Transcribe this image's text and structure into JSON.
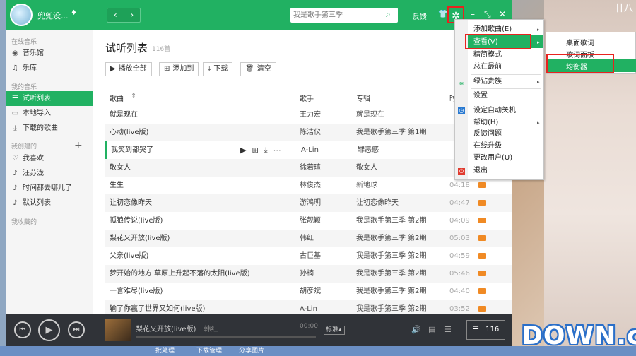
{
  "desktop": {
    "clock_char": "廿八"
  },
  "titlebar": {
    "username": "兜兜没...",
    "search_placeholder": "我是歌手第三季",
    "feedback": "反馈"
  },
  "sidebar": {
    "section_online": "在线音乐",
    "music_hall": "音乐馆",
    "library": "乐库",
    "section_my": "我的音乐",
    "trial_list": "试听列表",
    "local_import": "本地导入",
    "downloaded": "下载的歌曲",
    "section_created": "我创建的",
    "playlists": [
      "我喜欢",
      "汪苏泷",
      "时间都去哪儿了",
      "默认列表"
    ],
    "section_collected": "我收藏的"
  },
  "main": {
    "title": "试听列表",
    "count": "116首",
    "actions": {
      "play_all": "播放全部",
      "add_to": "添加到",
      "download": "下载",
      "clear": "清空"
    },
    "columns": {
      "song": "歌曲",
      "singer": "歌手",
      "album": "专辑",
      "duration": "时"
    },
    "rows": [
      {
        "song": "就是现在",
        "singer": "王力宏",
        "album": "就是现在",
        "duration": ""
      },
      {
        "song": "心动(live版)",
        "singer": "陈洁仪",
        "album": "我是歌手第三季 第1期",
        "duration": ""
      },
      {
        "song": "我笑到都哭了",
        "singer": "A-Lin",
        "album": "罪恶感",
        "duration": ""
      },
      {
        "song": "敬女人",
        "singer": "徐若瑄",
        "album": "敬女人",
        "duration": ""
      },
      {
        "song": "生生",
        "singer": "林俊杰",
        "album": "新地球",
        "duration": "04:18"
      },
      {
        "song": "让初恋像昨天",
        "singer": "游鸿明",
        "album": "让初恋像昨天",
        "duration": "04:47"
      },
      {
        "song": "孤狼传说(live版)",
        "singer": "张靓颖",
        "album": "我是歌手第三季 第2期",
        "duration": "04:09"
      },
      {
        "song": "梨花又开放(live版)",
        "singer": "韩红",
        "album": "我是歌手第三季 第2期",
        "duration": "05:03"
      },
      {
        "song": "父亲(live版)",
        "singer": "古巨基",
        "album": "我是歌手第三季 第2期",
        "duration": "04:59"
      },
      {
        "song": "梦开始的地方  草原上升起不落的太阳(live版)",
        "singer": "孙楠",
        "album": "我是歌手第三季 第2期",
        "duration": "05:46"
      },
      {
        "song": "一言难尽(live版)",
        "singer": "胡彦斌",
        "album": "我是歌手第三季 第2期",
        "duration": "04:40"
      },
      {
        "song": "输了你赢了世界又如何(live版)",
        "singer": "A-Lin",
        "album": "我是歌手第三季 第2期",
        "duration": "03:52"
      }
    ]
  },
  "menu": {
    "items": [
      {
        "label": "添加歌曲(E)",
        "arrow": true
      },
      {
        "label": "查看(V)",
        "arrow": true
      },
      {
        "label": "精简模式",
        "arrow": false
      },
      {
        "label": "总在最前",
        "arrow": false
      },
      {
        "label": "绿钻贵族",
        "arrow": true
      },
      {
        "label": "设置",
        "arrow": false
      },
      {
        "label": "设定自动关机",
        "arrow": false
      },
      {
        "label": "帮助(H)",
        "arrow": true
      },
      {
        "label": "反馈问题",
        "arrow": false
      },
      {
        "label": "在线升级",
        "arrow": false
      },
      {
        "label": "更改用户(U)",
        "arrow": false
      },
      {
        "label": "退出",
        "arrow": false
      }
    ],
    "sub_items": [
      "桌面歌词",
      "歌词面板",
      "均衡器"
    ]
  },
  "player": {
    "now_playing": "梨花又开放(live版)",
    "artist": "韩红",
    "time": "00:00",
    "quality": "标准",
    "list_count": "116"
  },
  "taskbar": {
    "items": [
      "批处理",
      "下载管理",
      "分享图片"
    ]
  },
  "watermark": "DOWN.cc",
  "colors": {
    "accent": "#21b162",
    "highlight_box": "#e8231f",
    "player_bg": "#303338"
  }
}
